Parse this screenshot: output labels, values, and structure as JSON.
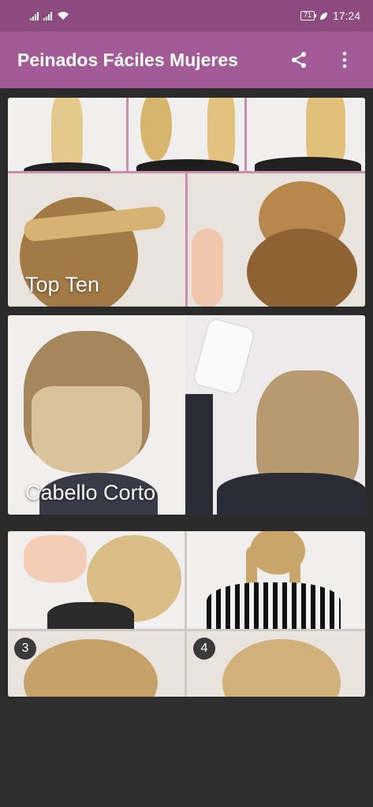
{
  "status_bar": {
    "battery": "71",
    "time": "17:24"
  },
  "app_bar": {
    "title": "Peinados Fáciles Mujeres",
    "share_icon": "share-icon",
    "menu_icon": "more-vert-icon"
  },
  "cards": [
    {
      "label": "Top Ten"
    },
    {
      "label": "Cabello Corto"
    },
    {
      "label": ""
    }
  ],
  "step_badges": [
    "3",
    "4"
  ],
  "colors": {
    "status_bar": "#8d4b80",
    "app_bar": "#a25b96",
    "background": "#2b2b2b"
  }
}
